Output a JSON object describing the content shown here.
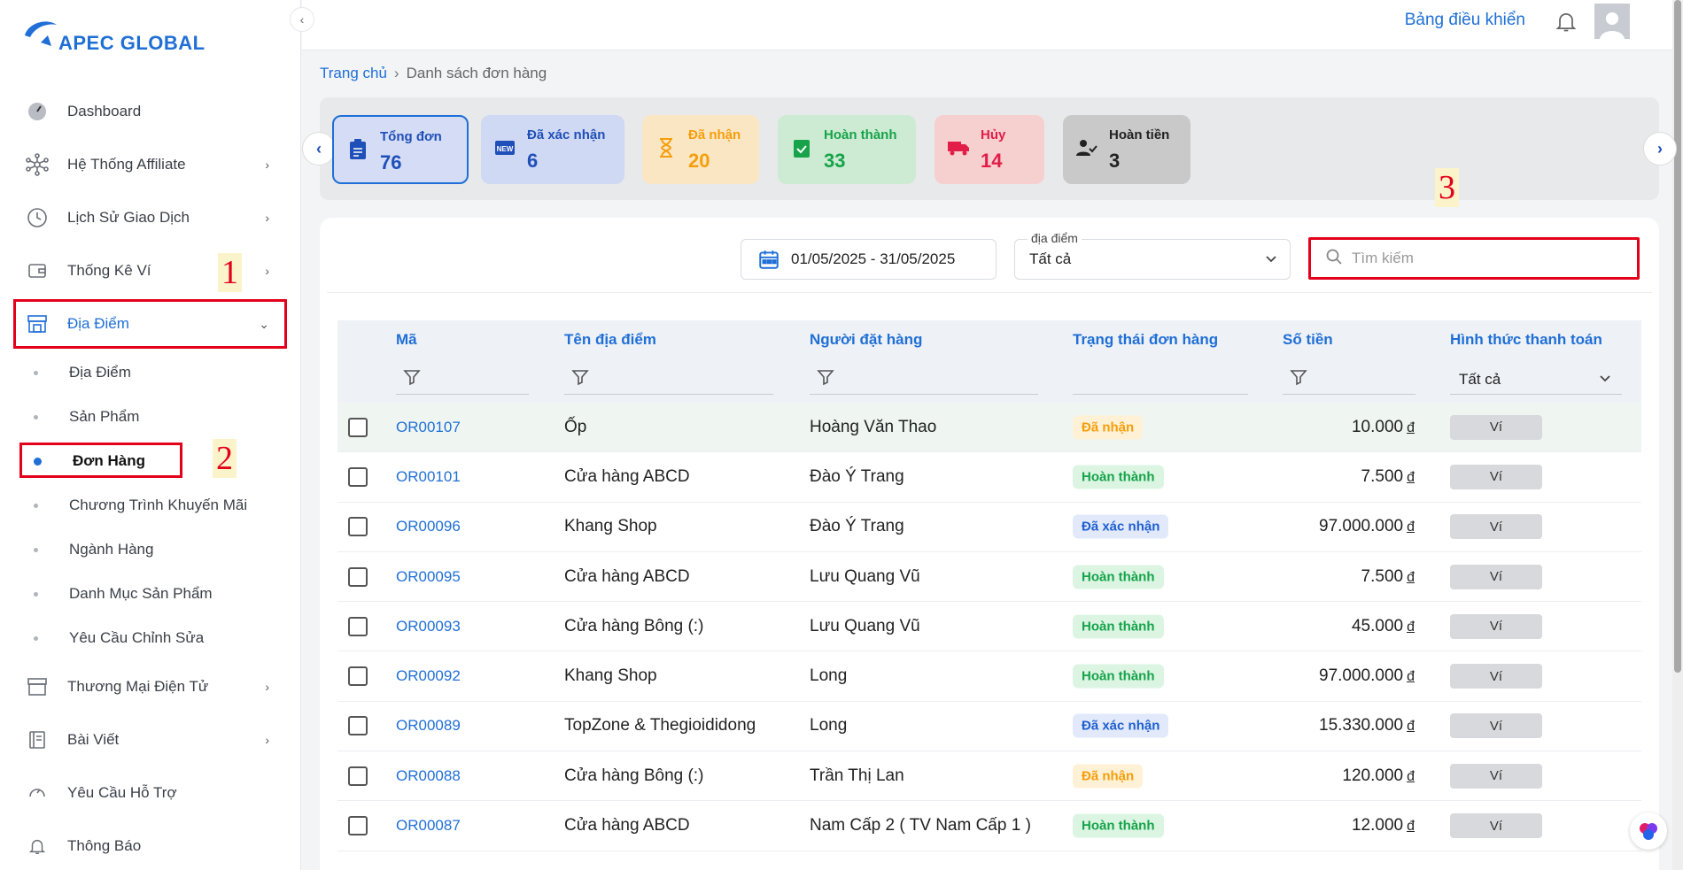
{
  "brand": {
    "name": "APEC GLOBAL"
  },
  "sidebar": {
    "items": [
      {
        "label": "Dashboard",
        "icon": "speedometer-icon"
      },
      {
        "label": "Hệ Thống Affiliate",
        "icon": "network-icon"
      },
      {
        "label": "Lịch Sử Giao Dịch",
        "icon": "history-icon"
      },
      {
        "label": "Thống Kê Ví",
        "icon": "wallet-icon"
      },
      {
        "label": "Địa Điểm",
        "icon": "store-icon"
      }
    ],
    "subitems": [
      {
        "label": "Địa Điểm"
      },
      {
        "label": "Sản Phẩm"
      },
      {
        "label": "Đơn Hàng"
      },
      {
        "label": "Chương Trình Khuyến Mãi"
      },
      {
        "label": "Ngành Hàng"
      },
      {
        "label": "Danh Mục Sản Phẩm"
      },
      {
        "label": "Yêu Cầu Chỉnh Sửa"
      }
    ],
    "items_after": [
      {
        "label": "Thương Mại Điện Tử",
        "icon": "shop-icon"
      },
      {
        "label": "Bài Viết",
        "icon": "notebook-icon"
      },
      {
        "label": "Yêu Cầu Hỗ Trợ",
        "icon": "support-icon"
      },
      {
        "label": "Thông Báo",
        "icon": "bell-icon"
      }
    ]
  },
  "annotations": {
    "one": "1",
    "two": "2",
    "three": "3"
  },
  "topbar": {
    "dashboard_link": "Bảng điều khiển"
  },
  "breadcrumb": {
    "home": "Trang chủ",
    "current": "Danh sách đơn hàng"
  },
  "stats": [
    {
      "title": "Tổng đơn",
      "value": "76",
      "color": "#1f4fb8",
      "bg": "#d4dcf6"
    },
    {
      "title": "Đã xác nhận",
      "value": "6",
      "color": "#1f4fb8",
      "bg": "#cfd9f4"
    },
    {
      "title": "Đã nhận",
      "value": "20",
      "color": "#f59e0b",
      "bg": "#fbe6c4"
    },
    {
      "title": "Hoàn thành",
      "value": "33",
      "color": "#16a34a",
      "bg": "#cdebd3"
    },
    {
      "title": "Hủy",
      "value": "14",
      "color": "#e11d48",
      "bg": "#f6cfcf"
    },
    {
      "title": "Hoàn tiền",
      "value": "3",
      "color": "#222222",
      "bg": "#c9c9c9"
    }
  ],
  "filters": {
    "date_range": "01/05/2025 - 31/05/2025",
    "location_label": "địa điểm",
    "location_value": "Tất cả",
    "search_placeholder": "Tìm kiếm"
  },
  "table": {
    "columns": {
      "code": "Mã",
      "location": "Tên địa điểm",
      "user": "Người đặt hàng",
      "status": "Trạng thái đơn hàng",
      "amount": "Số tiền",
      "payment": "Hình thức thanh toán"
    },
    "payment_filter": "Tất cả",
    "currency": "đ",
    "rows": [
      {
        "code": "OR00107",
        "location": "Ốp",
        "user": "Hoàng Văn Thao",
        "status": "Đã nhận",
        "amount": "10.000",
        "payment": "Ví"
      },
      {
        "code": "OR00101",
        "location": "Cửa hàng ABCD",
        "user": "Đào Ý Trang",
        "status": "Hoàn thành",
        "amount": "7.500",
        "payment": "Ví"
      },
      {
        "code": "OR00096",
        "location": "Khang Shop",
        "user": "Đào Ý Trang",
        "status": "Đã xác nhận",
        "amount": "97.000.000",
        "payment": "Ví"
      },
      {
        "code": "OR00095",
        "location": "Cửa hàng ABCD",
        "user": "Lưu Quang Vũ",
        "status": "Hoàn thành",
        "amount": "7.500",
        "payment": "Ví"
      },
      {
        "code": "OR00093",
        "location": "Cửa hàng Bông (:)",
        "user": "Lưu Quang Vũ",
        "status": "Hoàn thành",
        "amount": "45.000",
        "payment": "Ví"
      },
      {
        "code": "OR00092",
        "location": "Khang Shop",
        "user": "Long",
        "status": "Hoàn thành",
        "amount": "97.000.000",
        "payment": "Ví"
      },
      {
        "code": "OR00089",
        "location": "TopZone & Thegioididong",
        "user": "Long",
        "status": "Đã xác nhận",
        "amount": "15.330.000",
        "payment": "Ví"
      },
      {
        "code": "OR00088",
        "location": "Cửa hàng Bông (:)",
        "user": "Trần Thị Lan",
        "status": "Đã nhận",
        "amount": "120.000",
        "payment": "Ví"
      },
      {
        "code": "OR00087",
        "location": "Cửa hàng ABCD",
        "user": "Nam Cấp 2 ( TV Nam Cấp 1 )",
        "status": "Hoàn thành",
        "amount": "12.000",
        "payment": "Ví"
      }
    ]
  }
}
